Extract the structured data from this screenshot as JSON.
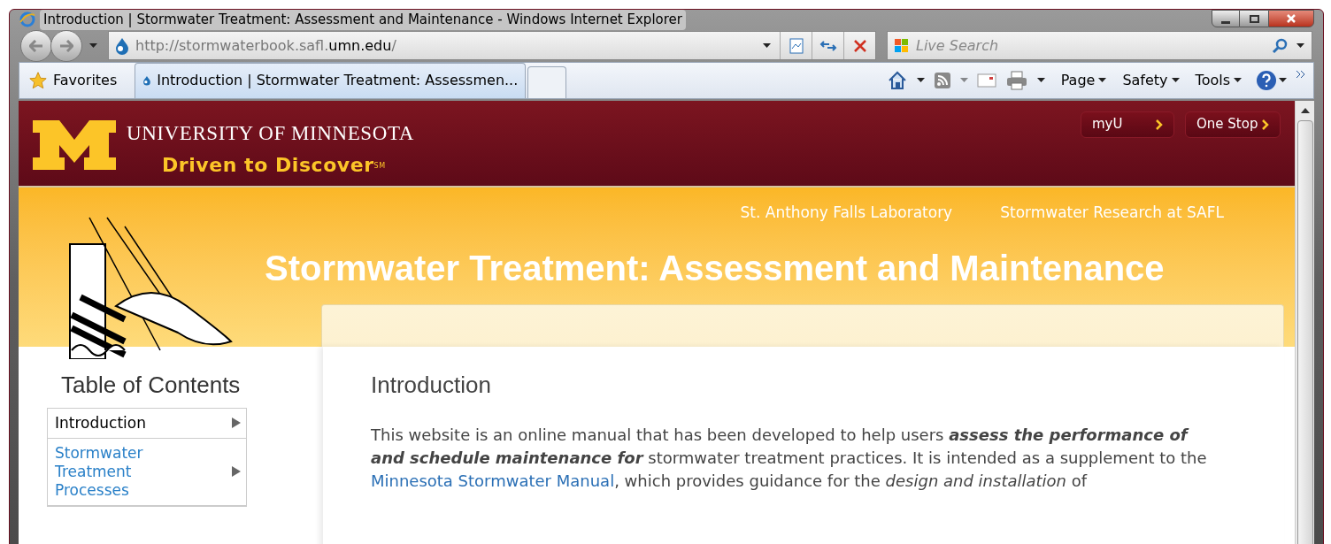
{
  "window": {
    "title": "Introduction | Stormwater Treatment: Assessment and Maintenance - Windows Internet Explorer"
  },
  "address_bar": {
    "url_parts": [
      {
        "text": "http://stormwaterbook.safl.",
        "kind": "dim"
      },
      {
        "text": "umn.edu",
        "kind": "domain"
      },
      {
        "text": "/",
        "kind": "dim"
      }
    ]
  },
  "search": {
    "placeholder": "Live Search"
  },
  "favorites": {
    "label": "Favorites"
  },
  "tabs": [
    {
      "label": "Introduction | Stormwater Treatment: Assessmen...",
      "selected": true
    }
  ],
  "command_bar": [
    {
      "label": "Page"
    },
    {
      "label": "Safety"
    },
    {
      "label": "Tools"
    }
  ],
  "header": {
    "wordmark": "UNIVERSITY OF MINNESOTA",
    "tagline": "Driven to Discover",
    "tagline_mark": "SM",
    "links": [
      {
        "label": "myU"
      },
      {
        "label": "One Stop"
      }
    ]
  },
  "banner": {
    "nav_links": [
      {
        "label": "St. Anthony Falls Laboratory"
      },
      {
        "label": "Stormwater Research at SAFL"
      }
    ],
    "title": "Stormwater Treatment: Assessment and Maintenance"
  },
  "toc": {
    "title": "Table of Contents",
    "items": [
      {
        "label": "Introduction",
        "selected": true
      },
      {
        "label": "Stormwater Treatment Processes",
        "selected": false
      }
    ]
  },
  "article": {
    "heading": "Introduction",
    "paragraph": [
      {
        "kind": "text",
        "text": "This website is an online manual that has been developed to help users "
      },
      {
        "kind": "strong",
        "text": "assess the performance of and schedule maintenance for"
      },
      {
        "kind": "text",
        "text": " stormwater treatment practices. It is intended as a supplement to the "
      },
      {
        "kind": "link",
        "text": "Minnesota Stormwater Manual"
      },
      {
        "kind": "text",
        "text": ", which provides guidance for the "
      },
      {
        "kind": "em",
        "text": "design and installation"
      },
      {
        "kind": "text",
        "text": " of"
      }
    ]
  }
}
